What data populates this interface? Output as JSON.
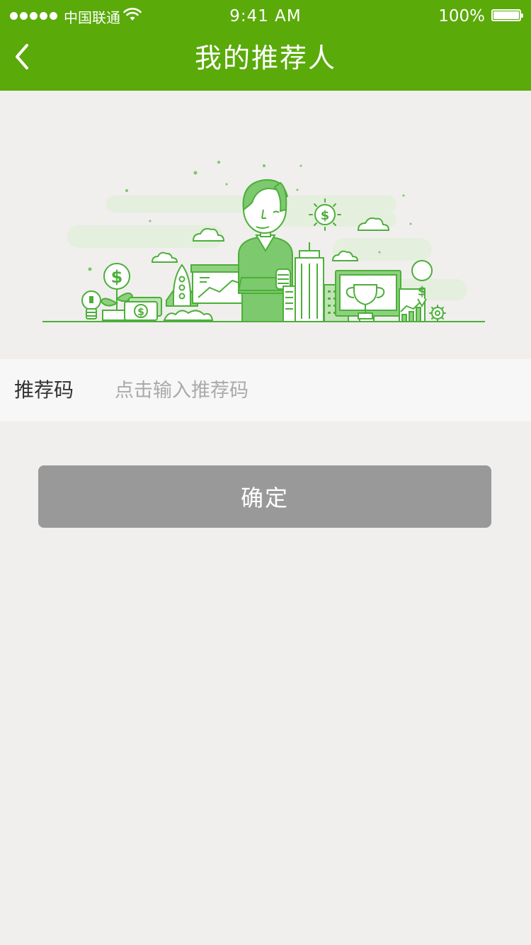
{
  "status_bar": {
    "carrier": "中国联通",
    "time": "9:41 AM",
    "battery": "100%"
  },
  "nav": {
    "title": "我的推荐人",
    "back_icon": "chevron-left-icon"
  },
  "illustration": {
    "theme_color": "#5aaa0a",
    "icons": [
      "person-thumbs-up",
      "dollar-sun-icon",
      "rocket-icon",
      "lightbulb-icon",
      "money-plant-icon",
      "cash-icon",
      "skyscraper-icon",
      "trophy-icon",
      "monitor-icon",
      "dollar-pin-icon",
      "gear-icon",
      "cloud-icon"
    ]
  },
  "form": {
    "label": "推荐码",
    "placeholder": "点击输入推荐码",
    "value": ""
  },
  "confirm": {
    "label": "确定",
    "color": "#999999"
  }
}
